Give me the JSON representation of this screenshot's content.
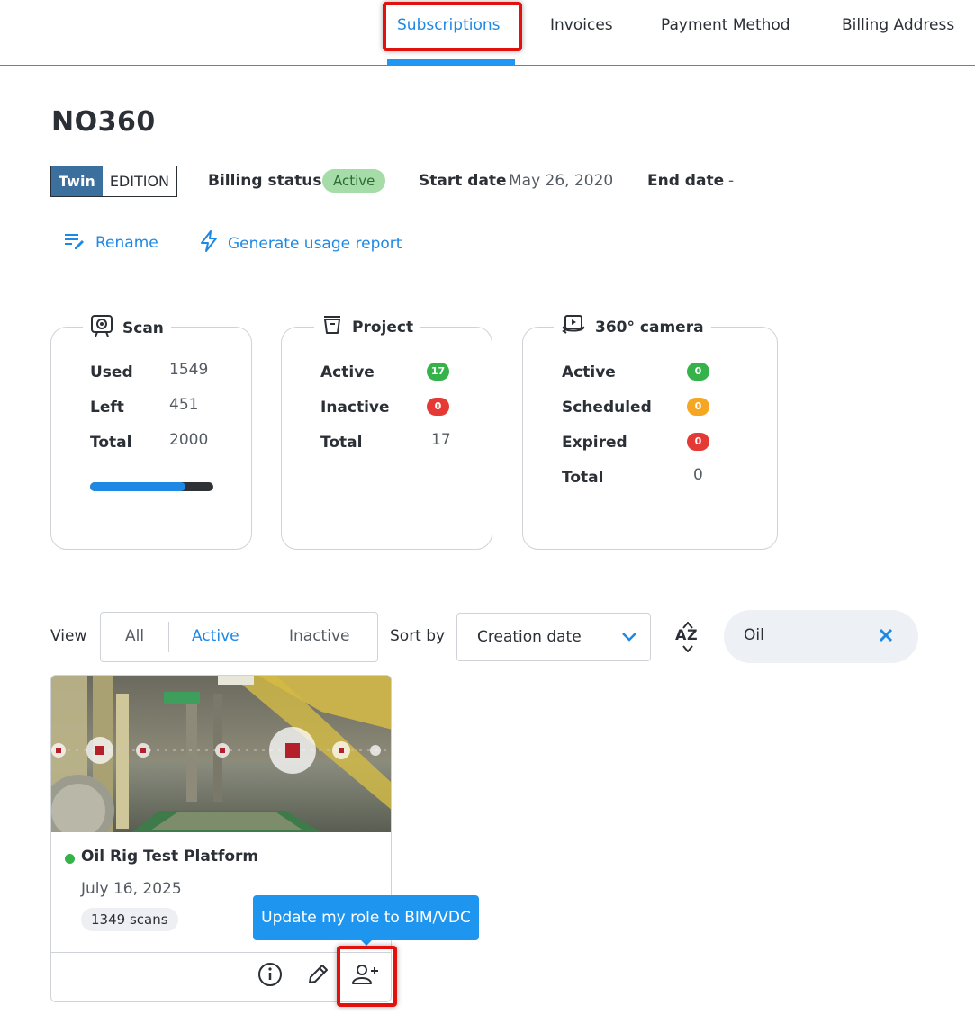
{
  "tabs": [
    {
      "label": "Subscriptions",
      "active": true
    },
    {
      "label": "Invoices",
      "active": false
    },
    {
      "label": "Payment Method",
      "active": false
    },
    {
      "label": "Billing Address",
      "active": false
    }
  ],
  "subscription": {
    "title": "NO360",
    "edition": {
      "name": "Twin",
      "suffix": "EDITION"
    },
    "billing_status_label": "Billing status",
    "billing_status": "Active",
    "start_date_label": "Start date",
    "start_date": "May 26, 2020",
    "end_date_label": "End date",
    "end_date": "-"
  },
  "actions": {
    "rename": "Rename",
    "usage_report": "Generate usage report"
  },
  "stats": {
    "scan": {
      "title": "Scan",
      "used_label": "Used",
      "used": "1549",
      "left_label": "Left",
      "left": "451",
      "total_label": "Total",
      "total": "2000",
      "progress_fraction": 0.7745
    },
    "project": {
      "title": "Project",
      "active_label": "Active",
      "active": "17",
      "inactive_label": "Inactive",
      "inactive": "0",
      "total_label": "Total",
      "total": "17"
    },
    "camera": {
      "title": "360° camera",
      "active_label": "Active",
      "active": "0",
      "scheduled_label": "Scheduled",
      "scheduled": "0",
      "expired_label": "Expired",
      "expired": "0",
      "total_label": "Total",
      "total": "0"
    }
  },
  "filters": {
    "view_label": "View",
    "view_options": [
      "All",
      "Active",
      "Inactive"
    ],
    "view_selected": "Active",
    "sort_label": "Sort by",
    "sort_value": "Creation date",
    "search_value": "Oil"
  },
  "project_card": {
    "name": "Oil Rig Test Platform",
    "date": "July 16, 2025",
    "scans": "1349 scans",
    "status": "active"
  },
  "tooltip": "Update my role to BIM/VDC",
  "colors": {
    "accent": "#1e88e5",
    "edition_bg": "#3b6f9e",
    "status_green": "#35b24a",
    "status_red": "#e53935",
    "status_orange": "#f5a623",
    "highlight": "#e3110d"
  }
}
